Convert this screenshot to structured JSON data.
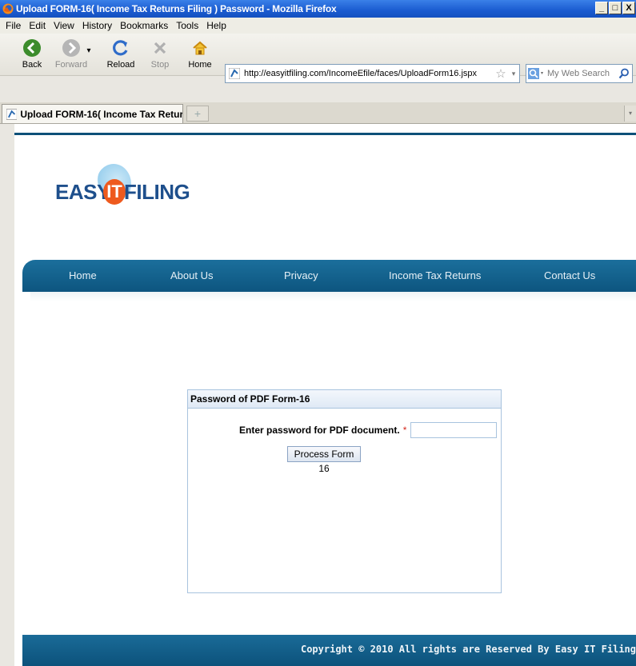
{
  "window": {
    "title": "Upload FORM-16( Income Tax Returns Filing ) Password - Mozilla Firefox",
    "min_label": "_",
    "max_label": "□",
    "close_label": "X"
  },
  "menu": {
    "items": [
      "File",
      "Edit",
      "View",
      "History",
      "Bookmarks",
      "Tools",
      "Help"
    ]
  },
  "toolbar": {
    "back_label": "Back",
    "forward_label": "Forward",
    "reload_label": "Reload",
    "stop_label": "Stop",
    "home_label": "Home",
    "url": "http://easyitfiling.com/IncomeEfile/faces/UploadForm16.jspx",
    "search_placeholder": "My Web Search"
  },
  "tabs": {
    "active_label": "Upload FORM-16( Income Tax Retur...",
    "new_tab_label": "+"
  },
  "page": {
    "logo": {
      "part1": "EASY",
      "part2": "IT",
      "part3": "FILING"
    },
    "nav": [
      "Home",
      "About Us",
      "Privacy",
      "Income Tax Returns",
      "Contact Us"
    ],
    "panel": {
      "title": "Password of PDF Form-16",
      "password_label": "Enter password for PDF document.",
      "required_mark": "*",
      "password_value": "",
      "submit_label": "Process Form 16"
    },
    "footer": {
      "copyright": "Copyright © 2010 All rights are Reserved By Easy IT Filing"
    }
  },
  "colors": {
    "nav_blue": "#0d557f",
    "logo_blue": "#1e4f8c",
    "logo_orange": "#ee5a1e",
    "required_red": "#d4261b"
  }
}
